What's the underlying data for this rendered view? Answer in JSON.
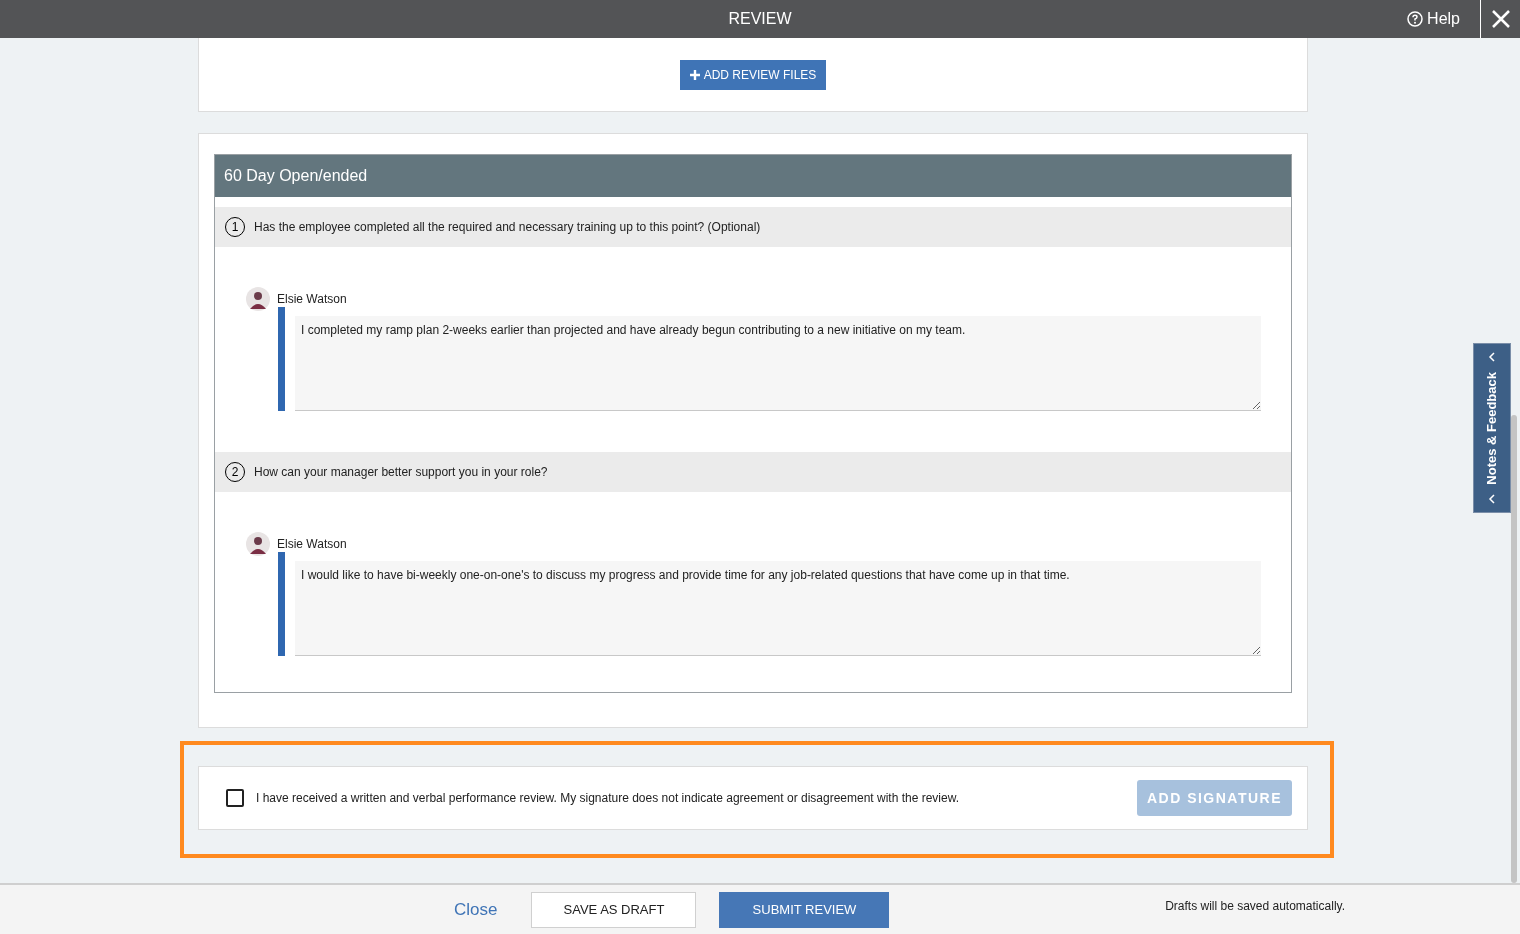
{
  "window": {
    "title": "REVIEW",
    "help": "Help"
  },
  "files_button": "ADD REVIEW FILES",
  "section": {
    "title": "60 Day Open/ended",
    "questions": [
      {
        "number": "1",
        "text": "Has the employee completed all the required and necessary training up to this point? (Optional)",
        "author": "Elsie Watson",
        "answer": "I completed my ramp plan 2-weeks earlier than projected and have already begun contributing to a new initiative on my team."
      },
      {
        "number": "2",
        "text": "How can your manager better support you in your role?",
        "author": "Elsie Watson",
        "answer": "I would like to have bi-weekly one-on-one's to discuss my progress and provide time for any job-related questions that have come up in that time."
      }
    ]
  },
  "acknowledgement": {
    "checked": false,
    "text": "I have received a written and verbal performance review. My signature does not indicate agreement or disagreement with the review.",
    "button": "ADD SIGNATURE",
    "disabled": true
  },
  "side_tab": "Notes & Feedback",
  "footer": {
    "close": "Close",
    "draft": "SAVE AS DRAFT",
    "submit": "SUBMIT REVIEW",
    "note": "Drafts will be saved automatically."
  }
}
